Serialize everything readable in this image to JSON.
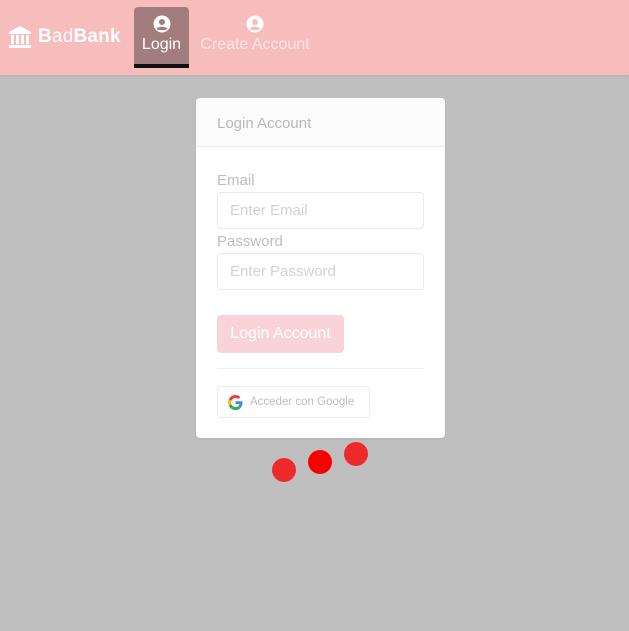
{
  "navbar": {
    "brand_bold_1": "B",
    "brand_light": "ad",
    "brand_bold_2": "Bank",
    "items": [
      {
        "label": "Login",
        "icon": "user-icon",
        "active": true
      },
      {
        "label": "Create Account",
        "icon": "user-icon",
        "active": false
      }
    ]
  },
  "card": {
    "title": "Login Account",
    "email_label": "Email",
    "email_placeholder": "Enter Email",
    "password_label": "Password",
    "password_placeholder": "Enter Password",
    "submit_label": "Login Account",
    "google_label": "Acceder con Google"
  },
  "colors": {
    "navbar": "#f7bcbc",
    "active_tab": "#a37d7d",
    "background": "#bfbfbf",
    "login_button": "#f9d3d7",
    "loading_dot": "#ef2a2a"
  }
}
